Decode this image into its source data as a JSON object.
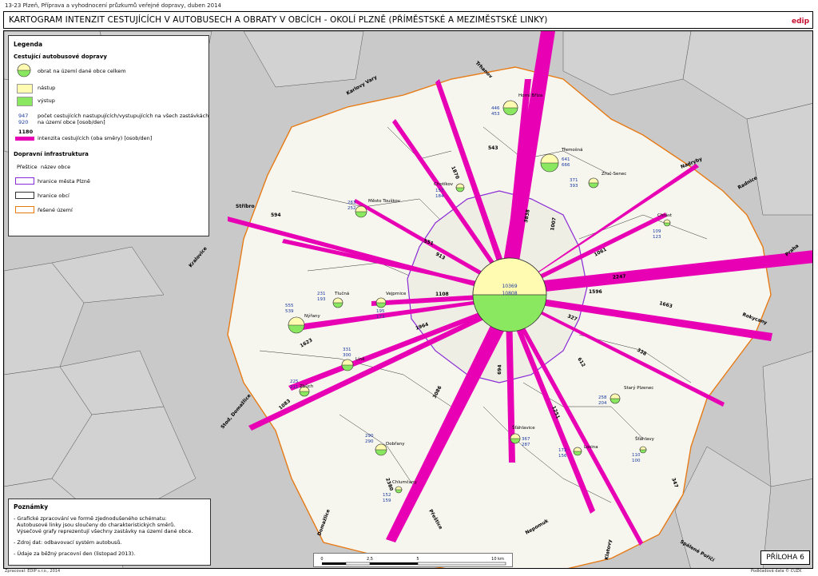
{
  "header": {
    "meta": "13-23 Plzeň, Příprava a vyhodnocení průzkumů veřejné dopravy, duben 2014",
    "title": "KARTOGRAM INTENZIT CESTUJÍCÍCH V AUTOBUSECH A OBRATY V OBCÍCH - OKOLÍ PLZNĚ (PŘÍMĚSTSKÉ A MEZIMĚSTSKÉ LINKY)",
    "logo_text": "edip"
  },
  "legend": {
    "title": "Legenda",
    "section1": "Cestující autobusové dopravy",
    "pie_label": "obrat na území dané obce celkem",
    "board_label": "nástup",
    "alight_label": "výstup",
    "count_top": "947",
    "count_bottom": "920",
    "count_label_1": "počet cestujících nastupujících/vystupujících na všech zastávkách",
    "count_label_2": "na území obce [osob/den]",
    "flow_value": "1180",
    "flow_label": "intenzita cestujících (oba směry) [osob/den]",
    "section2": "Dopravní infrastruktura",
    "town_sample": "Přeštice",
    "town_label": "název obce",
    "city_border_label": "hranice města Plzně",
    "muni_border_label": "hranice obcí",
    "area_label": "řešené území",
    "colors": {
      "flow": "#e800b4",
      "board": "#fffbb0",
      "alight": "#8ae860",
      "city_border": "#8a2bd6",
      "area": "#e87a14"
    }
  },
  "notes": {
    "title": "Poznámky",
    "line1": "- Grafické zpracování ve formě zjednodušeného schématu:",
    "line2": "Autobusové linky jsou sloučeny do charakteristických směrů.",
    "line3": "Výsečové grafy reprezentují všechny zastávky na území dané obce.",
    "line4": "- Zdroj dat: odbavovací systém autobusů.",
    "line5": "- Údaje za běžný pracovní den (listopad 2013)."
  },
  "scale": {
    "t0": "0",
    "t1": "2,5",
    "t2": "5",
    "t3": "10 km"
  },
  "annex": "PŘÍLOHA 6",
  "footer": {
    "left": "Zpracoval: EDIP s.r.o., 2014",
    "right": "Podkladová data © ČÚZK"
  },
  "center": {
    "board": "10369",
    "alight": "10808"
  },
  "towns": [
    {
      "name": "Horní Bříza",
      "board": "446",
      "alight": "453"
    },
    {
      "name": "Třemošná",
      "board": "641",
      "alight": "666"
    },
    {
      "name": "Chotíkov",
      "board": "157",
      "alight": "184"
    },
    {
      "name": "Město Touškov",
      "board": "263",
      "alight": "252"
    },
    {
      "name": "Nýřany",
      "board": "555",
      "alight": "539"
    },
    {
      "name": "Tlučná",
      "board": "231",
      "alight": "193"
    },
    {
      "name": "Vejprnice",
      "board": "195",
      "alight": "173"
    },
    {
      "name": "Líně",
      "board": "331",
      "alight": "300"
    },
    {
      "name": "Zbůch",
      "board": "225",
      "alight": "211"
    },
    {
      "name": "Dobřany",
      "board": "290",
      "alight": "290"
    },
    {
      "name": "Šťáhlavy",
      "board": "110",
      "alight": "100"
    },
    {
      "name": "Starý Plzenec",
      "board": "258",
      "alight": "204"
    },
    {
      "name": "Chrást",
      "board": "109",
      "alight": "123"
    },
    {
      "name": "Zruč-Senec",
      "board": "371",
      "alight": "393"
    },
    {
      "name": "Šťáhlavice",
      "board": "367",
      "alight": "287"
    },
    {
      "name": "Losina",
      "board": "172",
      "alight": "156"
    },
    {
      "name": "Chlumčany",
      "board": "152",
      "alight": "159"
    }
  ],
  "flows": [
    {
      "dir": "north",
      "value": "3838"
    },
    {
      "dir": "north-2",
      "value": "1007"
    },
    {
      "dir": "north-west",
      "value": "1870"
    },
    {
      "dir": "west-1",
      "value": "913"
    },
    {
      "dir": "west-2",
      "value": "551"
    },
    {
      "dir": "west-3",
      "value": "1108"
    },
    {
      "dir": "west-4",
      "value": "1964"
    },
    {
      "dir": "south-west",
      "value": "3086"
    },
    {
      "dir": "south",
      "value": "694"
    },
    {
      "dir": "south-2",
      "value": "1251"
    },
    {
      "dir": "south-east",
      "value": "612"
    },
    {
      "dir": "east-1",
      "value": "2247"
    },
    {
      "dir": "east-2",
      "value": "1596"
    },
    {
      "dir": "east-3",
      "value": "1061"
    },
    {
      "dir": "east-4",
      "value": "327"
    },
    {
      "dir": "minor",
      "value": "594"
    },
    {
      "dir": "minor-2",
      "value": "1623"
    },
    {
      "dir": "minor-3",
      "value": "1083"
    },
    {
      "dir": "minor-4",
      "value": "1663"
    },
    {
      "dir": "minor-5",
      "value": "2380"
    },
    {
      "dir": "minor-6",
      "value": "338"
    },
    {
      "dir": "minor-7",
      "value": "347"
    },
    {
      "dir": "minor-8",
      "value": "543"
    }
  ],
  "directions": [
    {
      "name": "Stříbro"
    },
    {
      "name": "Kralovice"
    },
    {
      "name": "Praha"
    },
    {
      "name": "Rokycany"
    },
    {
      "name": "Nepomuk"
    },
    {
      "name": "Přeštice"
    },
    {
      "name": "Domažlice"
    },
    {
      "name": "Klatovy"
    },
    {
      "name": "Spálené Poříčí"
    },
    {
      "name": "Karlovy Vary"
    },
    {
      "name": "Nadryby"
    },
    {
      "name": "Radnice"
    },
    {
      "name": "Trhanov"
    },
    {
      "name": "Stod, Domažlice"
    }
  ]
}
